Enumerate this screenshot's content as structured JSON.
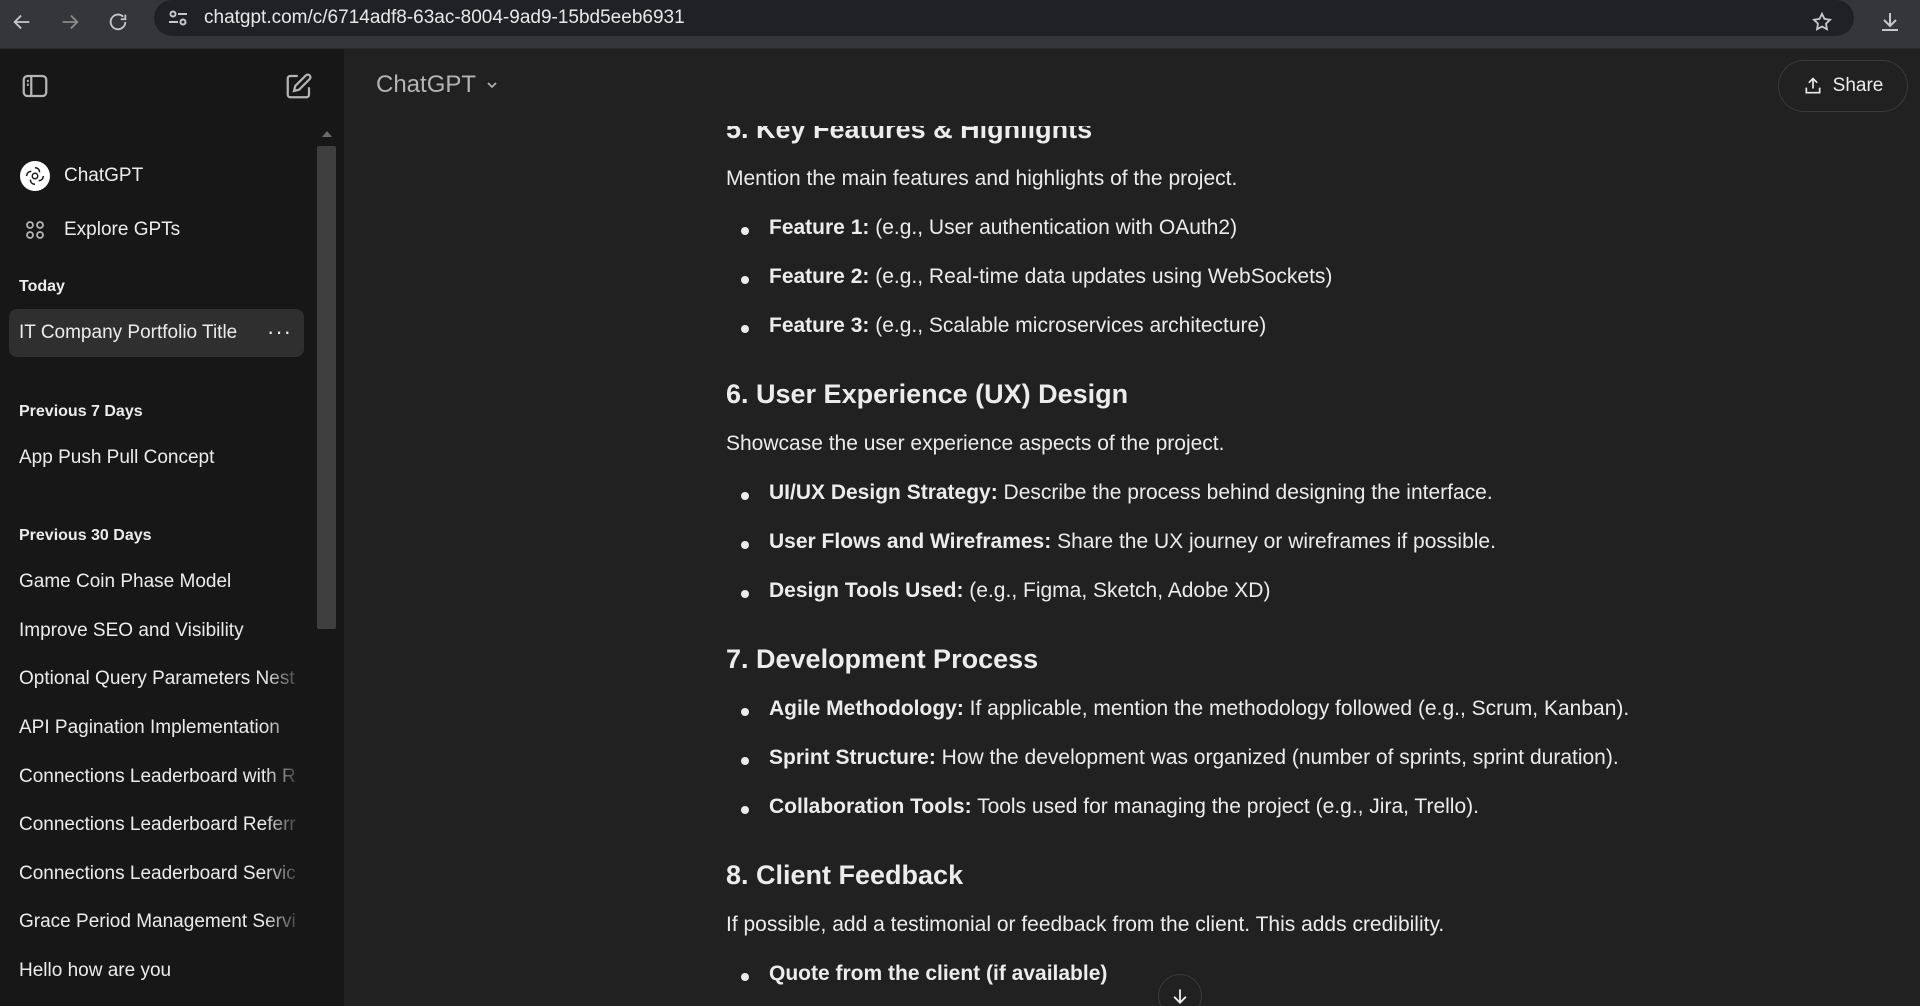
{
  "browser": {
    "url": "chatgpt.com/c/6714adf8-63ac-8004-9ad9-15bd5eeb6931"
  },
  "sidebar": {
    "top_items": [
      {
        "label": "ChatGPT",
        "icon": "openai-logo-icon"
      },
      {
        "label": "Explore GPTs",
        "icon": "grid-icon"
      }
    ],
    "sections": [
      {
        "title": "Today",
        "items": [
          "IT Company Portfolio Title"
        ]
      },
      {
        "title": "Previous 7 Days",
        "items": [
          "App Push Pull Concept"
        ]
      },
      {
        "title": "Previous 30 Days",
        "items": [
          "Game Coin Phase Model",
          "Improve SEO and Visibility",
          "Optional Query Parameters Nest",
          "API Pagination Implementation",
          "Connections Leaderboard with R",
          "Connections Leaderboard Referr",
          "Connections Leaderboard Servic",
          "Grace Period Management Servi",
          "Hello how are you"
        ]
      }
    ],
    "active_item_more": "···"
  },
  "header": {
    "model": "ChatGPT",
    "share_label": "Share"
  },
  "content": {
    "h5": "5. Key Features & Highlights",
    "p5": "Mention the main features and highlights of the project.",
    "list5": [
      {
        "b": "Feature 1:",
        "t": " (e.g., User authentication with OAuth2)"
      },
      {
        "b": "Feature 2:",
        "t": " (e.g., Real-time data updates using WebSockets)"
      },
      {
        "b": "Feature 3:",
        "t": " (e.g., Scalable microservices architecture)"
      }
    ],
    "h6": "6. User Experience (UX) Design",
    "p6": "Showcase the user experience aspects of the project.",
    "list6": [
      {
        "b": "UI/UX Design Strategy:",
        "t": " Describe the process behind designing the interface."
      },
      {
        "b": "User Flows and Wireframes:",
        "t": " Share the UX journey or wireframes if possible."
      },
      {
        "b": "Design Tools Used:",
        "t": " (e.g., Figma, Sketch, Adobe XD)"
      }
    ],
    "h7": "7. Development Process",
    "list7": [
      {
        "b": "Agile Methodology:",
        "t": " If applicable, mention the methodology followed (e.g., Scrum, Kanban)."
      },
      {
        "b": "Sprint Structure:",
        "t": " How the development was organized (number of sprints, sprint duration)."
      },
      {
        "b": "Collaboration Tools:",
        "t": " Tools used for managing the project (e.g., Jira, Trello)."
      }
    ],
    "h8": "8. Client Feedback",
    "p8": "If possible, add a testimonial or feedback from the client. This adds credibility.",
    "list8": [
      {
        "b": "Quote from the client (if available)",
        "t": ""
      }
    ]
  },
  "colors": {
    "sidebar_bg": "#171717",
    "main_bg": "#212121",
    "text": "#ececec",
    "active_item_bg": "#2f2f2f"
  }
}
